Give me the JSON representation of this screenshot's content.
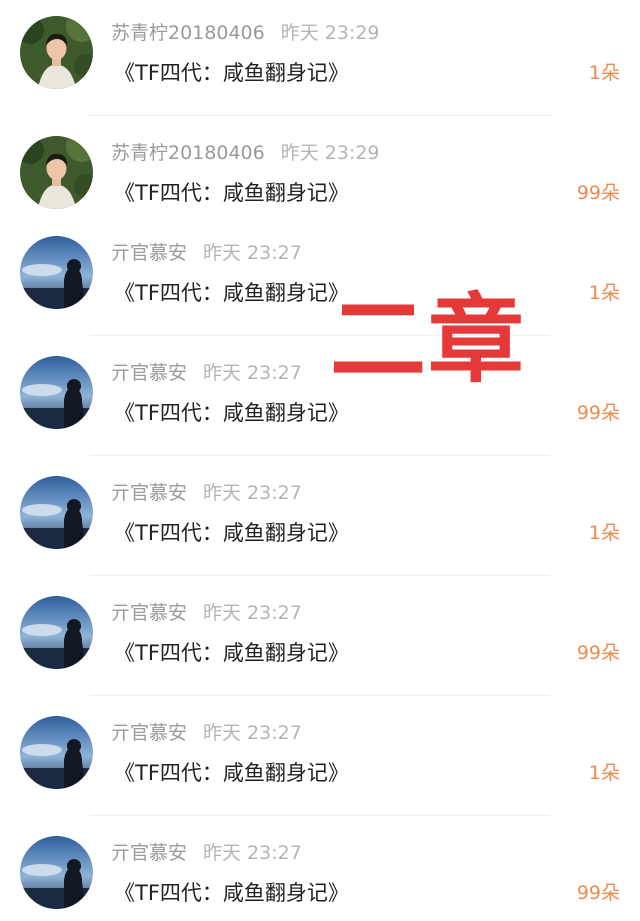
{
  "items": [
    {
      "name": "苏青柠20180406",
      "time": "昨天 23:29",
      "title": "《TF四代：咸鱼翻身记》",
      "count": "1朵",
      "avatar": "male-portrait-avatar"
    },
    {
      "name": "苏青柠20180406",
      "time": "昨天 23:29",
      "title": "《TF四代：咸鱼翻身记》",
      "count": "99朵",
      "avatar": "male-portrait-avatar"
    },
    {
      "name": "亓官慕安",
      "time": "昨天 23:27",
      "title": "《TF四代：咸鱼翻身记》",
      "count": "1朵",
      "avatar": "sky-silhouette-avatar"
    },
    {
      "name": "亓官慕安",
      "time": "昨天 23:27",
      "title": "《TF四代：咸鱼翻身记》",
      "count": "99朵",
      "avatar": "sky-silhouette-avatar"
    },
    {
      "name": "亓官慕安",
      "time": "昨天 23:27",
      "title": "《TF四代：咸鱼翻身记》",
      "count": "1朵",
      "avatar": "sky-silhouette-avatar"
    },
    {
      "name": "亓官慕安",
      "time": "昨天 23:27",
      "title": "《TF四代：咸鱼翻身记》",
      "count": "99朵",
      "avatar": "sky-silhouette-avatar"
    },
    {
      "name": "亓官慕安",
      "time": "昨天 23:27",
      "title": "《TF四代：咸鱼翻身记》",
      "count": "1朵",
      "avatar": "sky-silhouette-avatar"
    },
    {
      "name": "亓官慕安",
      "time": "昨天 23:27",
      "title": "《TF四代：咸鱼翻身记》",
      "count": "99朵",
      "avatar": "sky-silhouette-avatar"
    }
  ],
  "overlay_text": "二章",
  "colors": {
    "count": "#ec8a52",
    "overlay": "#e53939",
    "name": "#9a9a9a",
    "title": "#222222"
  }
}
